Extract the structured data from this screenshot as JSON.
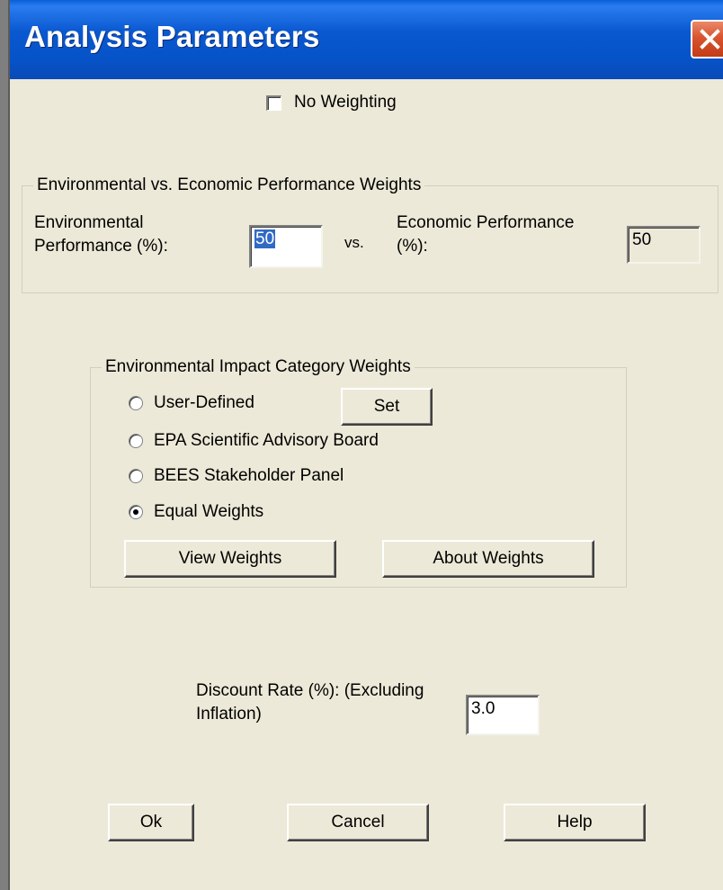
{
  "window": {
    "title": "Analysis Parameters",
    "close_icon": "close-icon"
  },
  "no_weighting": {
    "label": "No Weighting",
    "checked": false
  },
  "env_econ_group": {
    "legend": "Environmental vs. Economic Performance Weights",
    "environmental_label_line1": "Environmental",
    "environmental_label_line2": "Performance (%):",
    "environmental_value": "50",
    "vs_label": "vs.",
    "economic_label_line1": "Economic Performance",
    "economic_label_line2": "(%):",
    "economic_value": "50"
  },
  "impact_group": {
    "legend": "Environmental Impact Category Weights",
    "options": [
      {
        "label": "User-Defined",
        "checked": false
      },
      {
        "label": "EPA Scientific Advisory Board",
        "checked": false
      },
      {
        "label": "BEES Stakeholder Panel",
        "checked": false
      },
      {
        "label": "Equal Weights",
        "checked": true
      }
    ],
    "set_button": "Set",
    "view_weights_button": "View Weights",
    "about_weights_button": "About Weights"
  },
  "discount": {
    "label_line1": "Discount Rate (%): (Excluding",
    "label_line2": "Inflation)",
    "value": "3.0"
  },
  "buttons": {
    "ok": "Ok",
    "cancel": "Cancel",
    "help": "Help"
  }
}
